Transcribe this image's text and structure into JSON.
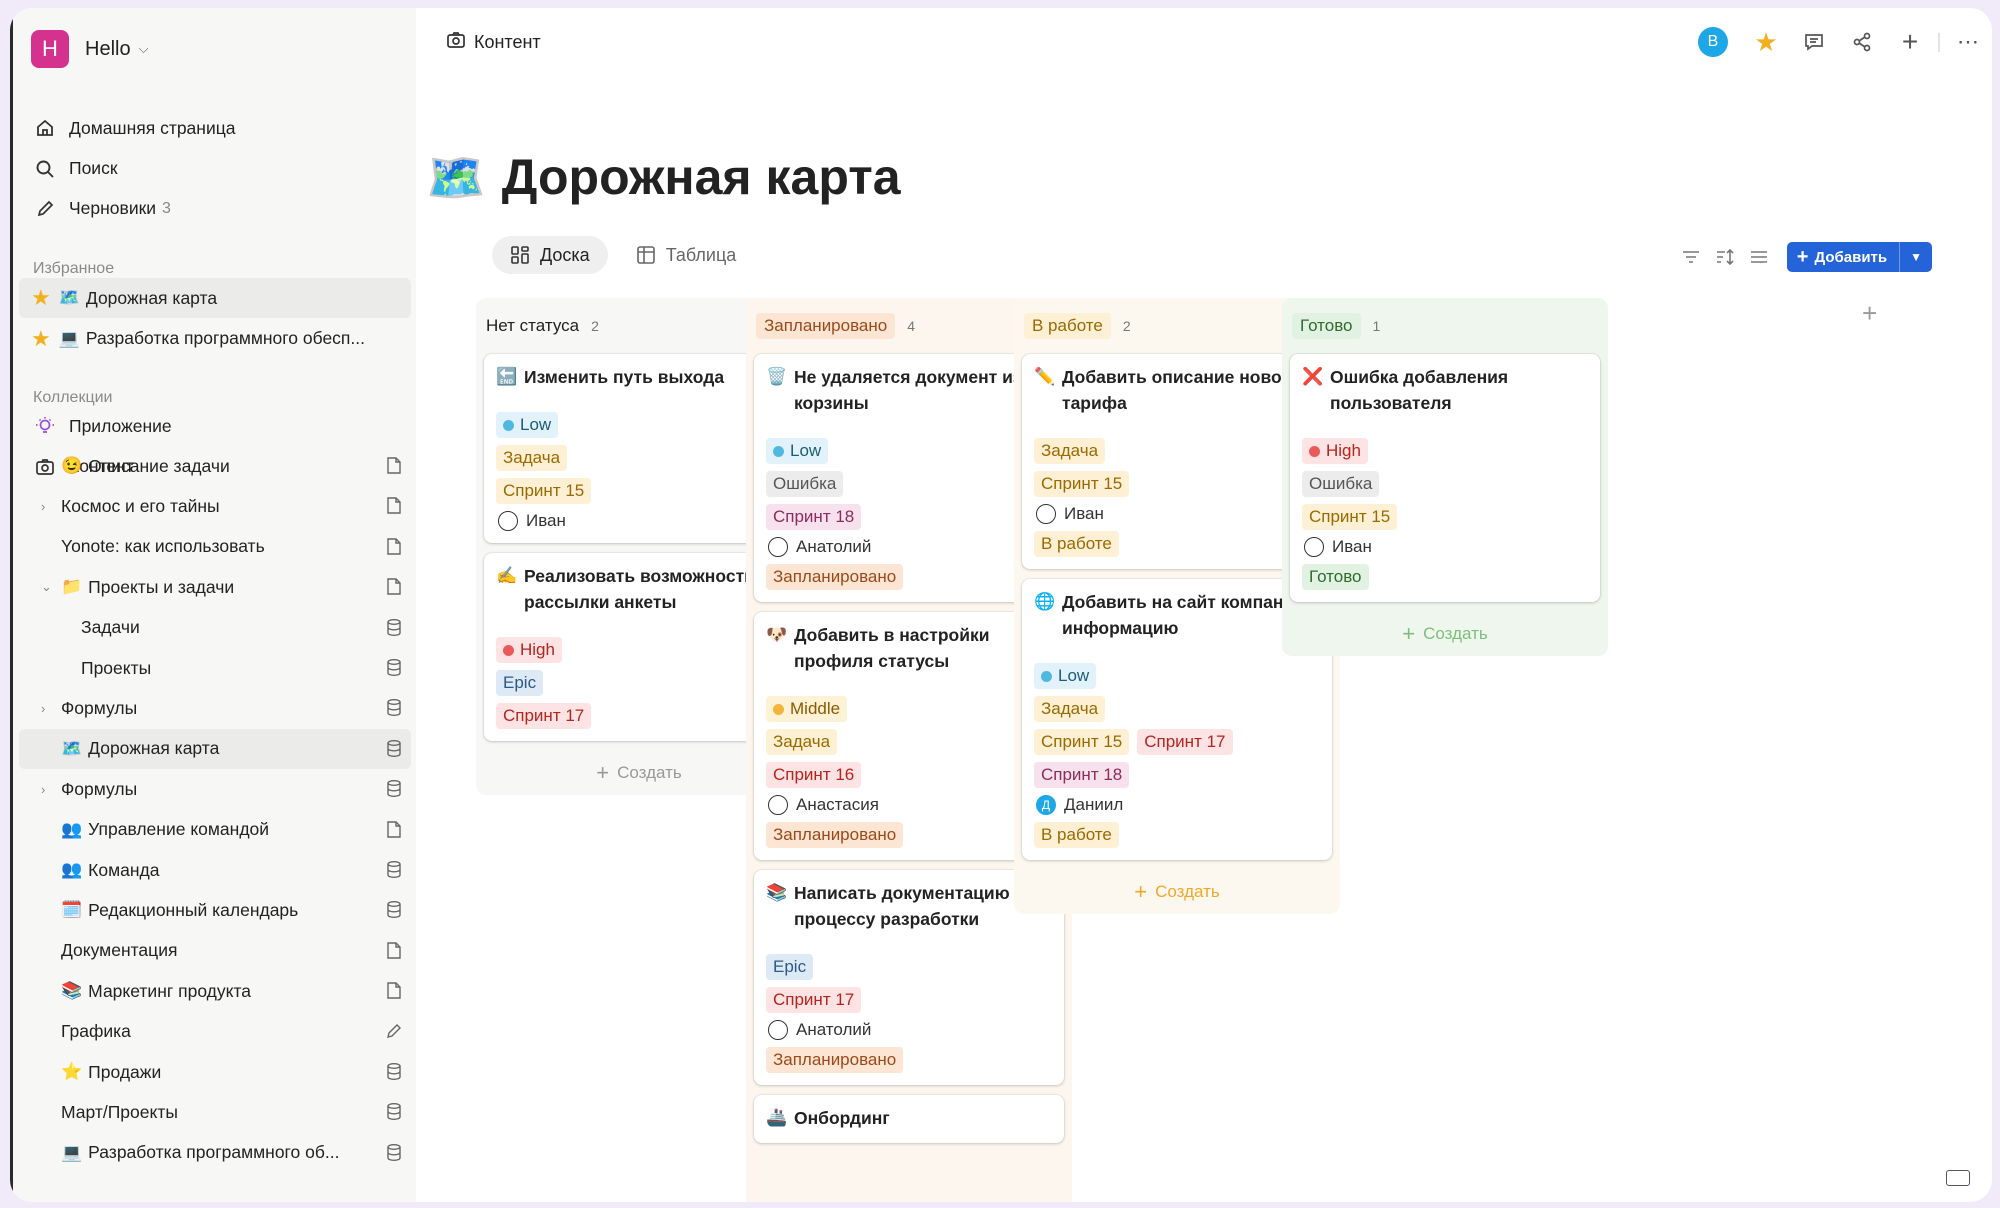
{
  "workspace": {
    "initial": "H",
    "name": "Hello"
  },
  "nav": [
    {
      "label": "Домашняя страница",
      "icon": "home-icon"
    },
    {
      "label": "Поиск",
      "icon": "search-icon"
    },
    {
      "label": "Черновики",
      "icon": "pencil-icon",
      "count": "3"
    }
  ],
  "favorites": {
    "title": "Избранное",
    "items": [
      {
        "label": "Дорожная карта",
        "emoji": "🗺️"
      },
      {
        "label": "Разработка программного обесп...",
        "emoji": "💻"
      }
    ]
  },
  "collections": {
    "title": "Коллекции",
    "items": [
      {
        "label": "Приложение"
      },
      {
        "label": "Контент"
      }
    ]
  },
  "tree": [
    {
      "label": "Описание задачи",
      "emoji": "😉",
      "type": "page"
    },
    {
      "label": "Космос и его тайны",
      "type": "page"
    },
    {
      "label": "Yonote: как использовать",
      "type": "page"
    },
    {
      "label": "Проекты и задачи",
      "emoji": "📁",
      "type": "page"
    },
    {
      "label": "Задачи",
      "type": "db"
    },
    {
      "label": "Проекты",
      "type": "db"
    },
    {
      "label": "Формулы",
      "type": "db"
    },
    {
      "label": "Дорожная карта",
      "emoji": "🗺️",
      "type": "db"
    },
    {
      "label": "Формулы",
      "type": "db"
    },
    {
      "label": "Управление командой",
      "emoji": "👥",
      "type": "page"
    },
    {
      "label": "Команда",
      "emoji": "👥",
      "type": "db"
    },
    {
      "label": "Редакционный календарь",
      "emoji": "🗓️",
      "type": "db"
    },
    {
      "label": "Документация",
      "type": "page"
    },
    {
      "label": "Маркетинг продукта",
      "emoji": "📚",
      "type": "page"
    },
    {
      "label": "Графика",
      "type": "edit"
    },
    {
      "label": "Продажи",
      "emoji": "⭐",
      "type": "db"
    },
    {
      "label": "Март/Проекты",
      "type": "db"
    },
    {
      "label": "Разработка программного об...",
      "emoji": "💻",
      "type": "db"
    }
  ],
  "header": {
    "breadcrumb": "Контент",
    "avatar": "В"
  },
  "page": {
    "emoji": "🗺️",
    "title": "Дорожная карта"
  },
  "views": [
    {
      "label": "Доска"
    },
    {
      "label": "Таблица"
    }
  ],
  "toolbar": {
    "add_label": "Добавить"
  },
  "board": {
    "create_label": "Создать",
    "columns": [
      {
        "name": "Нет статуса",
        "count": "2",
        "cards": [
          {
            "emoji": "🔚",
            "title": "Изменить путь выхода",
            "props": [
              {
                "tags": [
                  {
                    "text": "Low",
                    "cls": "t-low",
                    "dot": "#4fb8e0"
                  }
                ]
              },
              {
                "tags": [
                  {
                    "text": "Задача",
                    "cls": "t-task"
                  }
                ]
              },
              {
                "tags": [
                  {
                    "text": "Спринт 15",
                    "cls": "t-s15"
                  }
                ]
              },
              {
                "person": "Иван"
              }
            ]
          },
          {
            "emoji": "✍️",
            "title": "Реализовать возможность рассылки анкеты",
            "props": [
              {
                "tags": [
                  {
                    "text": "High",
                    "cls": "t-high",
                    "dot": "#ea5a5a"
                  }
                ]
              },
              {
                "tags": [
                  {
                    "text": "Epic",
                    "cls": "t-epic"
                  }
                ]
              },
              {
                "tags": [
                  {
                    "text": "Спринт 17",
                    "cls": "t-s17"
                  }
                ]
              }
            ]
          }
        ]
      },
      {
        "name": "Запланировано",
        "count": "4",
        "cards": [
          {
            "emoji": "🗑️",
            "title": "Не удаляется документ из корзины",
            "props": [
              {
                "tags": [
                  {
                    "text": "Low",
                    "cls": "t-low",
                    "dot": "#4fb8e0"
                  }
                ]
              },
              {
                "tags": [
                  {
                    "text": "Ошибка",
                    "cls": "t-bug"
                  }
                ]
              },
              {
                "tags": [
                  {
                    "text": "Спринт 18",
                    "cls": "t-s18"
                  }
                ]
              },
              {
                "person": "Анатолий"
              },
              {
                "tags": [
                  {
                    "text": "Запланировано",
                    "cls": "t-plan"
                  }
                ]
              }
            ]
          },
          {
            "emoji": "🐶",
            "title": "Добавить в настройки профиля статусы",
            "props": [
              {
                "tags": [
                  {
                    "text": "Middle",
                    "cls": "t-mid",
                    "dot": "#f2b43a"
                  }
                ]
              },
              {
                "tags": [
                  {
                    "text": "Задача",
                    "cls": "t-task"
                  }
                ]
              },
              {
                "tags": [
                  {
                    "text": "Спринт 16",
                    "cls": "t-s16"
                  }
                ]
              },
              {
                "person": "Анастасия"
              },
              {
                "tags": [
                  {
                    "text": "Запланировано",
                    "cls": "t-plan"
                  }
                ]
              }
            ]
          },
          {
            "emoji": "📚",
            "title": "Написать документацию по процессу разработки",
            "props": [
              {
                "tags": [
                  {
                    "text": "Epic",
                    "cls": "t-epic"
                  }
                ]
              },
              {
                "tags": [
                  {
                    "text": "Спринт 17",
                    "cls": "t-s17"
                  }
                ]
              },
              {
                "person": "Анатолий"
              },
              {
                "tags": [
                  {
                    "text": "Запланировано",
                    "cls": "t-plan"
                  }
                ]
              }
            ]
          },
          {
            "emoji": "🚢",
            "title": "Онбординг",
            "props": []
          }
        ]
      },
      {
        "name": "В работе",
        "count": "2",
        "cards": [
          {
            "emoji": "✏️",
            "title": "Добавить описание нового тарифа",
            "props": [
              {
                "tags": [
                  {
                    "text": "Задача",
                    "cls": "t-task"
                  }
                ]
              },
              {
                "tags": [
                  {
                    "text": "Спринт 15",
                    "cls": "t-s15"
                  }
                ]
              },
              {
                "person": "Иван"
              },
              {
                "tags": [
                  {
                    "text": "В работе",
                    "cls": "t-work"
                  }
                ]
              }
            ]
          },
          {
            "emoji": "🌐",
            "title": "Добавить на сайт компании информацию",
            "props": [
              {
                "tags": [
                  {
                    "text": "Low",
                    "cls": "t-low",
                    "dot": "#4fb8e0"
                  }
                ]
              },
              {
                "tags": [
                  {
                    "text": "Задача",
                    "cls": "t-task"
                  }
                ]
              },
              {
                "tags": [
                  {
                    "text": "Спринт 15",
                    "cls": "t-s15"
                  },
                  {
                    "text": "Спринт 17",
                    "cls": "t-s17"
                  }
                ]
              },
              {
                "tags": [
                  {
                    "text": "Спринт 18",
                    "cls": "t-s18"
                  }
                ]
              },
              {
                "person": "Даниил",
                "initial": "Д"
              },
              {
                "tags": [
                  {
                    "text": "В работе",
                    "cls": "t-work"
                  }
                ]
              }
            ]
          }
        ]
      },
      {
        "name": "Готово",
        "count": "1",
        "cards": [
          {
            "emoji": "❌",
            "title": "Ошибка добавления пользователя",
            "props": [
              {
                "tags": [
                  {
                    "text": "High",
                    "cls": "t-high",
                    "dot": "#ea5a5a"
                  }
                ]
              },
              {
                "tags": [
                  {
                    "text": "Ошибка",
                    "cls": "t-bug"
                  }
                ]
              },
              {
                "tags": [
                  {
                    "text": "Спринт 15",
                    "cls": "t-s15"
                  }
                ]
              },
              {
                "person": "Иван"
              },
              {
                "tags": [
                  {
                    "text": "Готово",
                    "cls": "t-done"
                  }
                ]
              }
            ]
          }
        ]
      }
    ]
  },
  "colors": {
    "accent": "#2563d9",
    "workspace": "#d5318f",
    "col_none": "#f7f7f5",
    "col_plan": "#fdf6ef",
    "col_work": "#fdf8ef",
    "col_done": "#eff6ee"
  }
}
